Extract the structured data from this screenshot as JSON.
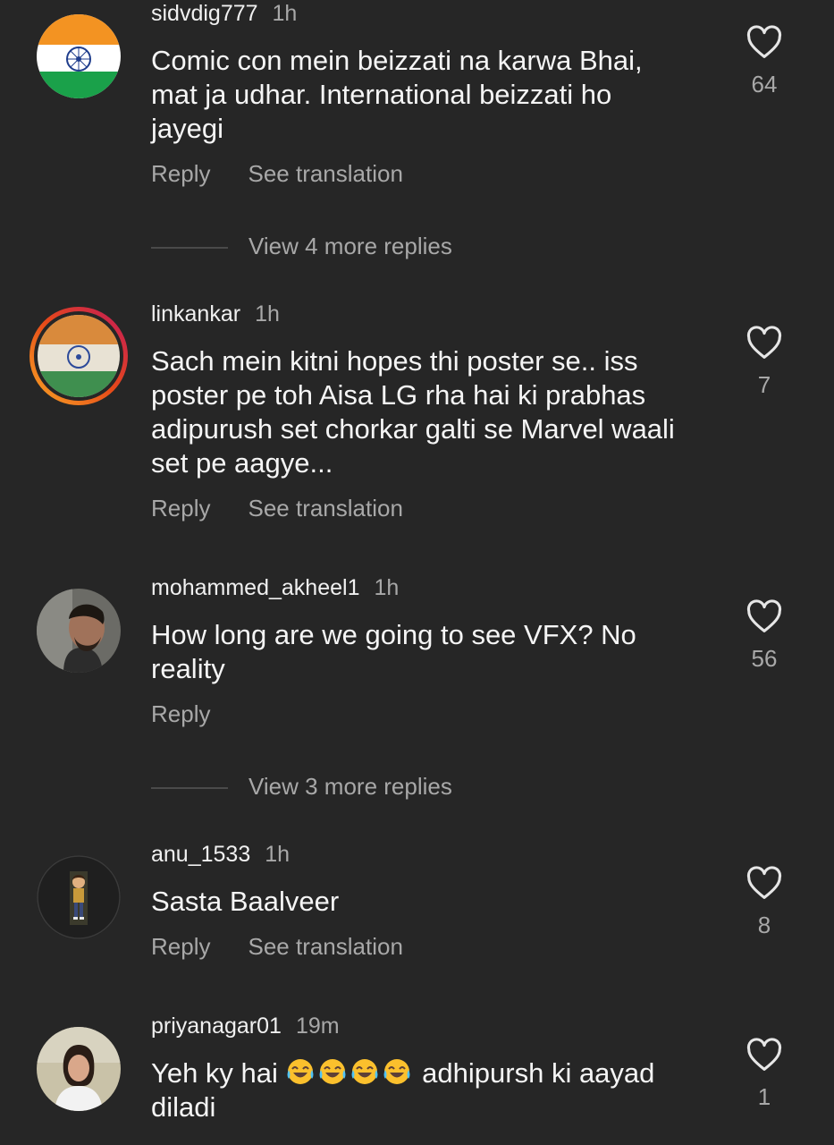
{
  "comments": [
    {
      "username": "sidvdig777",
      "time": "1h",
      "text": "Comic con mein beizzati na karwa Bhai, mat ja udhar. International beizzati ho jayegi",
      "reply_label": "Reply",
      "translation_label": "See translation",
      "likes": "64",
      "view_more": "View 4 more replies",
      "avatar_icon": "india-flag-avatar"
    },
    {
      "username": "linkankar",
      "time": "1h",
      "text": "Sach mein kitni hopes thi poster se.. iss poster pe toh Aisa LG rha hai ki prabhas adipurush set chorkar galti se Marvel waali set pe aagye...",
      "reply_label": "Reply",
      "translation_label": "See translation",
      "likes": "7",
      "avatar_icon": "india-flag-story-ring-avatar"
    },
    {
      "username": "mohammed_akheel1",
      "time": "1h",
      "text": "How long are we going to see VFX? No reality",
      "reply_label": "Reply",
      "likes": "56",
      "view_more": "View 3 more replies",
      "avatar_icon": "man-profile-photo-avatar"
    },
    {
      "username": "anu_1533",
      "time": "1h",
      "text": "Sasta Baalveer",
      "reply_label": "Reply",
      "translation_label": "See translation",
      "likes": "8",
      "avatar_icon": "cartoon-figure-avatar"
    },
    {
      "username": "priyanagar01",
      "time": "19m",
      "text_before": "Yeh ky hai",
      "emojis": [
        "laughing-tears-emoji",
        "laughing-tears-emoji",
        "laughing-tears-emoji",
        "laughing-tears-emoji"
      ],
      "text_after": "adhipursh ki aayad",
      "text_line2": "diladi",
      "likes": "1",
      "avatar_icon": "woman-profile-photo-avatar"
    }
  ],
  "icons": {
    "like": "heart-outline-icon"
  },
  "colors": {
    "background": "#262626",
    "primary_text": "#f5f5f5",
    "secondary_text": "#a8a8a8",
    "story_ring_start": "#f9a825",
    "story_ring_end": "#c2185b"
  }
}
